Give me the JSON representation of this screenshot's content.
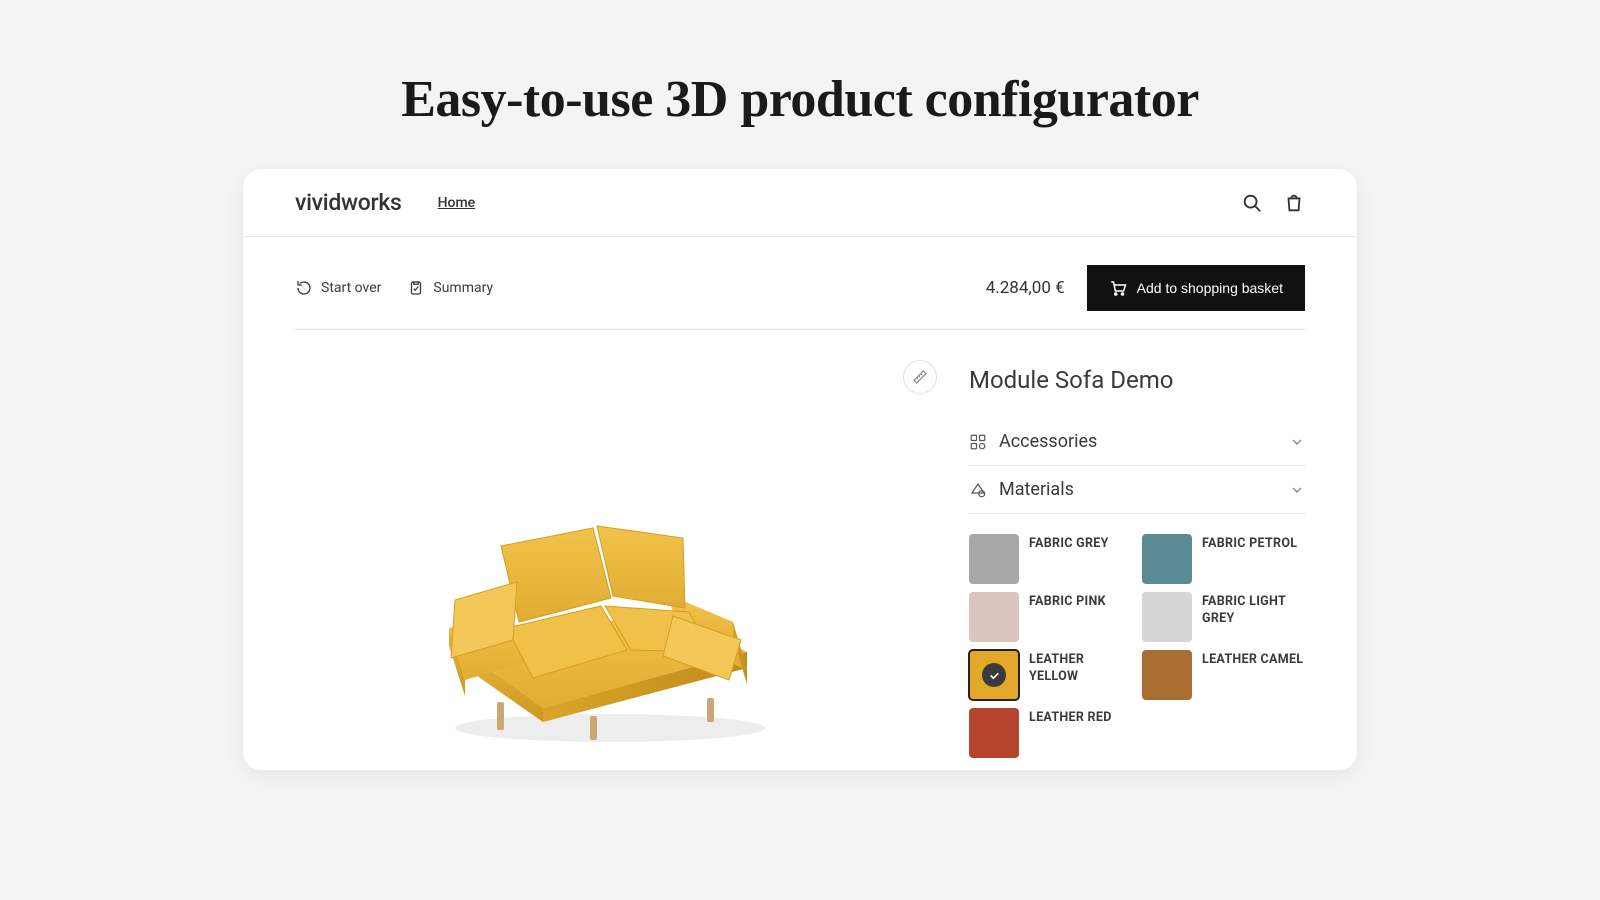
{
  "page": {
    "title": "Easy-to-use 3D product configurator"
  },
  "topbar": {
    "brand": "vividworks",
    "nav_home": "Home"
  },
  "actionbar": {
    "start_over": "Start over",
    "summary": "Summary",
    "price": "4.284,00 €",
    "add_to_basket": "Add to shopping basket"
  },
  "product": {
    "title": "Module Sofa Demo"
  },
  "panels": {
    "accessories": "Accessories",
    "materials": "Materials"
  },
  "swatches": [
    {
      "id": "fabric-grey",
      "label": "FABRIC GREY",
      "color": "#a8a8a8",
      "selected": false
    },
    {
      "id": "fabric-petrol",
      "label": "FABRIC PETROL",
      "color": "#5a8a94",
      "selected": false
    },
    {
      "id": "fabric-pink",
      "label": "FABRIC PINK",
      "color": "#dcc4bf",
      "selected": false
    },
    {
      "id": "fabric-light-grey",
      "label": "FABRIC LIGHT GREY",
      "color": "#d6d6d4",
      "selected": false
    },
    {
      "id": "leather-yellow",
      "label": "LEATHER YELLOW",
      "color": "#e3a82a",
      "selected": true
    },
    {
      "id": "leather-camel",
      "label": "LEATHER CAMEL",
      "color": "#aa6e33",
      "selected": false
    },
    {
      "id": "leather-red",
      "label": "LEATHER RED",
      "color": "#b6432c",
      "selected": false
    }
  ]
}
